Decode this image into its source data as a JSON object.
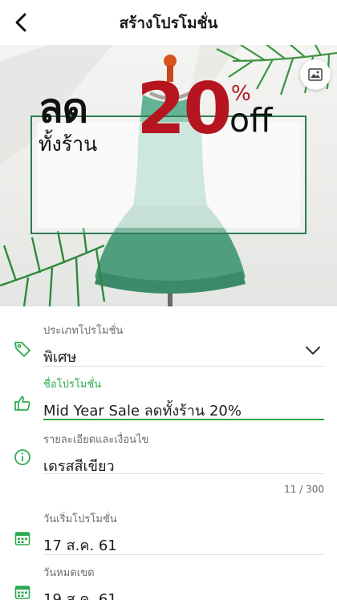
{
  "header": {
    "title": "สร้างโปรโมชั่น"
  },
  "banner": {
    "headline_main": "ลด",
    "headline_sub": "ทั้งร้าน",
    "discount_number": "20",
    "percent_sign": "%",
    "off_text": "off"
  },
  "form": {
    "promo_type": {
      "label": "ประเภทโปรโมชั่น",
      "value": "พิเศษ"
    },
    "promo_name": {
      "label": "ชื่อโปรโมชั่น",
      "value": "Mid Year Sale ลดทั้งร้าน 20%"
    },
    "details": {
      "label": "รายละเอียดและเงื่อนไข",
      "value": "เดรสสีเขียว",
      "counter": "11 / 300"
    },
    "start_date": {
      "label": "วันเริ่มโปรโมชั่น",
      "value": "17 ส.ค. 61"
    },
    "end_date": {
      "label": "วันหมดเขต",
      "value": "19 ส.ค. 61"
    }
  },
  "colors": {
    "accent": "#22a447",
    "discount_red": "#b5151f",
    "frame_green": "#2e7d55",
    "dress_green": "#5aa889"
  },
  "icons": [
    "chevron-left-icon",
    "image-icon",
    "tag-icon",
    "thumbs-up-icon",
    "info-icon",
    "calendar-icon",
    "chevron-down-icon"
  ]
}
